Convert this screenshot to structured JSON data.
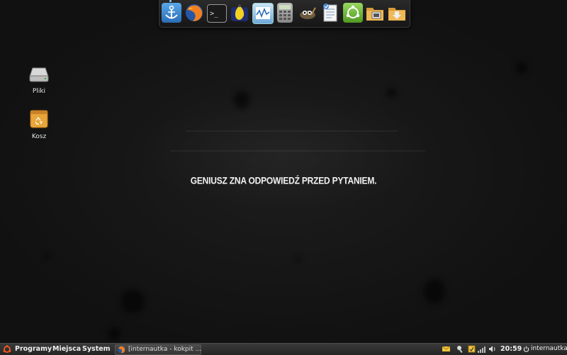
{
  "desktop": {
    "headline": "GENIUSZ ZNA ODPOWIEDŹ PRZED PYTANIEM.",
    "icons": [
      {
        "label": "Pliki",
        "icon": "drive-icon"
      },
      {
        "label": "Kosz",
        "icon": "trash-icon"
      }
    ]
  },
  "dock": {
    "items": [
      {
        "name": "anchor-icon"
      },
      {
        "name": "firefox-icon"
      },
      {
        "name": "terminal-icon"
      },
      {
        "name": "network-tool-icon"
      },
      {
        "name": "system-monitor-icon"
      },
      {
        "name": "calculator-icon"
      },
      {
        "name": "gimp-icon"
      },
      {
        "name": "text-editor-icon"
      },
      {
        "name": "software-center-icon"
      },
      {
        "name": "folder-icon"
      },
      {
        "name": "downloads-folder-icon"
      }
    ]
  },
  "panel": {
    "menus": [
      "Programy",
      "Miejsca",
      "System"
    ],
    "task_label": "[internautka - kokpit ...",
    "clock": "20:59",
    "user": "internautka"
  },
  "colors": {
    "wallpaper": "#151515",
    "panel": "#2c2c2c",
    "folder": "#e8a53a"
  }
}
